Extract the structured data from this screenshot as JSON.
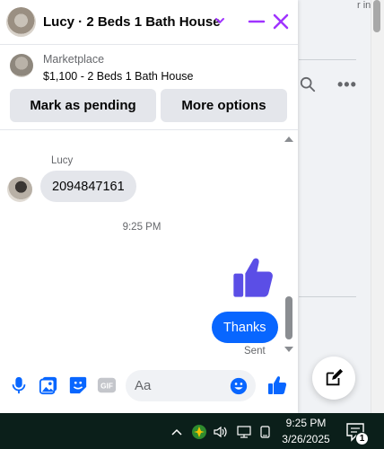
{
  "chat": {
    "title": "Lucy · 2 Beds 1 Bath House",
    "marketplace_label": "Marketplace",
    "listing": "$1,100 - 2 Beds 1 Bath House",
    "buttons": {
      "pending": "Mark as pending",
      "more": "More options"
    },
    "messages": {
      "sender_name": "Lucy",
      "incoming_text": "2094847161",
      "timestamp": "9:25 PM",
      "outgoing_text": "Thanks",
      "status": "Sent"
    },
    "composer": {
      "placeholder": "Aa",
      "icons": [
        "microphone-icon",
        "photo-icon",
        "sticker-icon",
        "gif-icon",
        "emoji-icon",
        "like-icon"
      ]
    },
    "colors": {
      "accent": "#a033ff",
      "blue": "#0866ff",
      "like_purple": "#5b4ee6"
    }
  },
  "background": {
    "edge_text": "r instan"
  },
  "taskbar": {
    "time": "9:25 PM",
    "date": "3/26/2025",
    "notifications": "1"
  }
}
